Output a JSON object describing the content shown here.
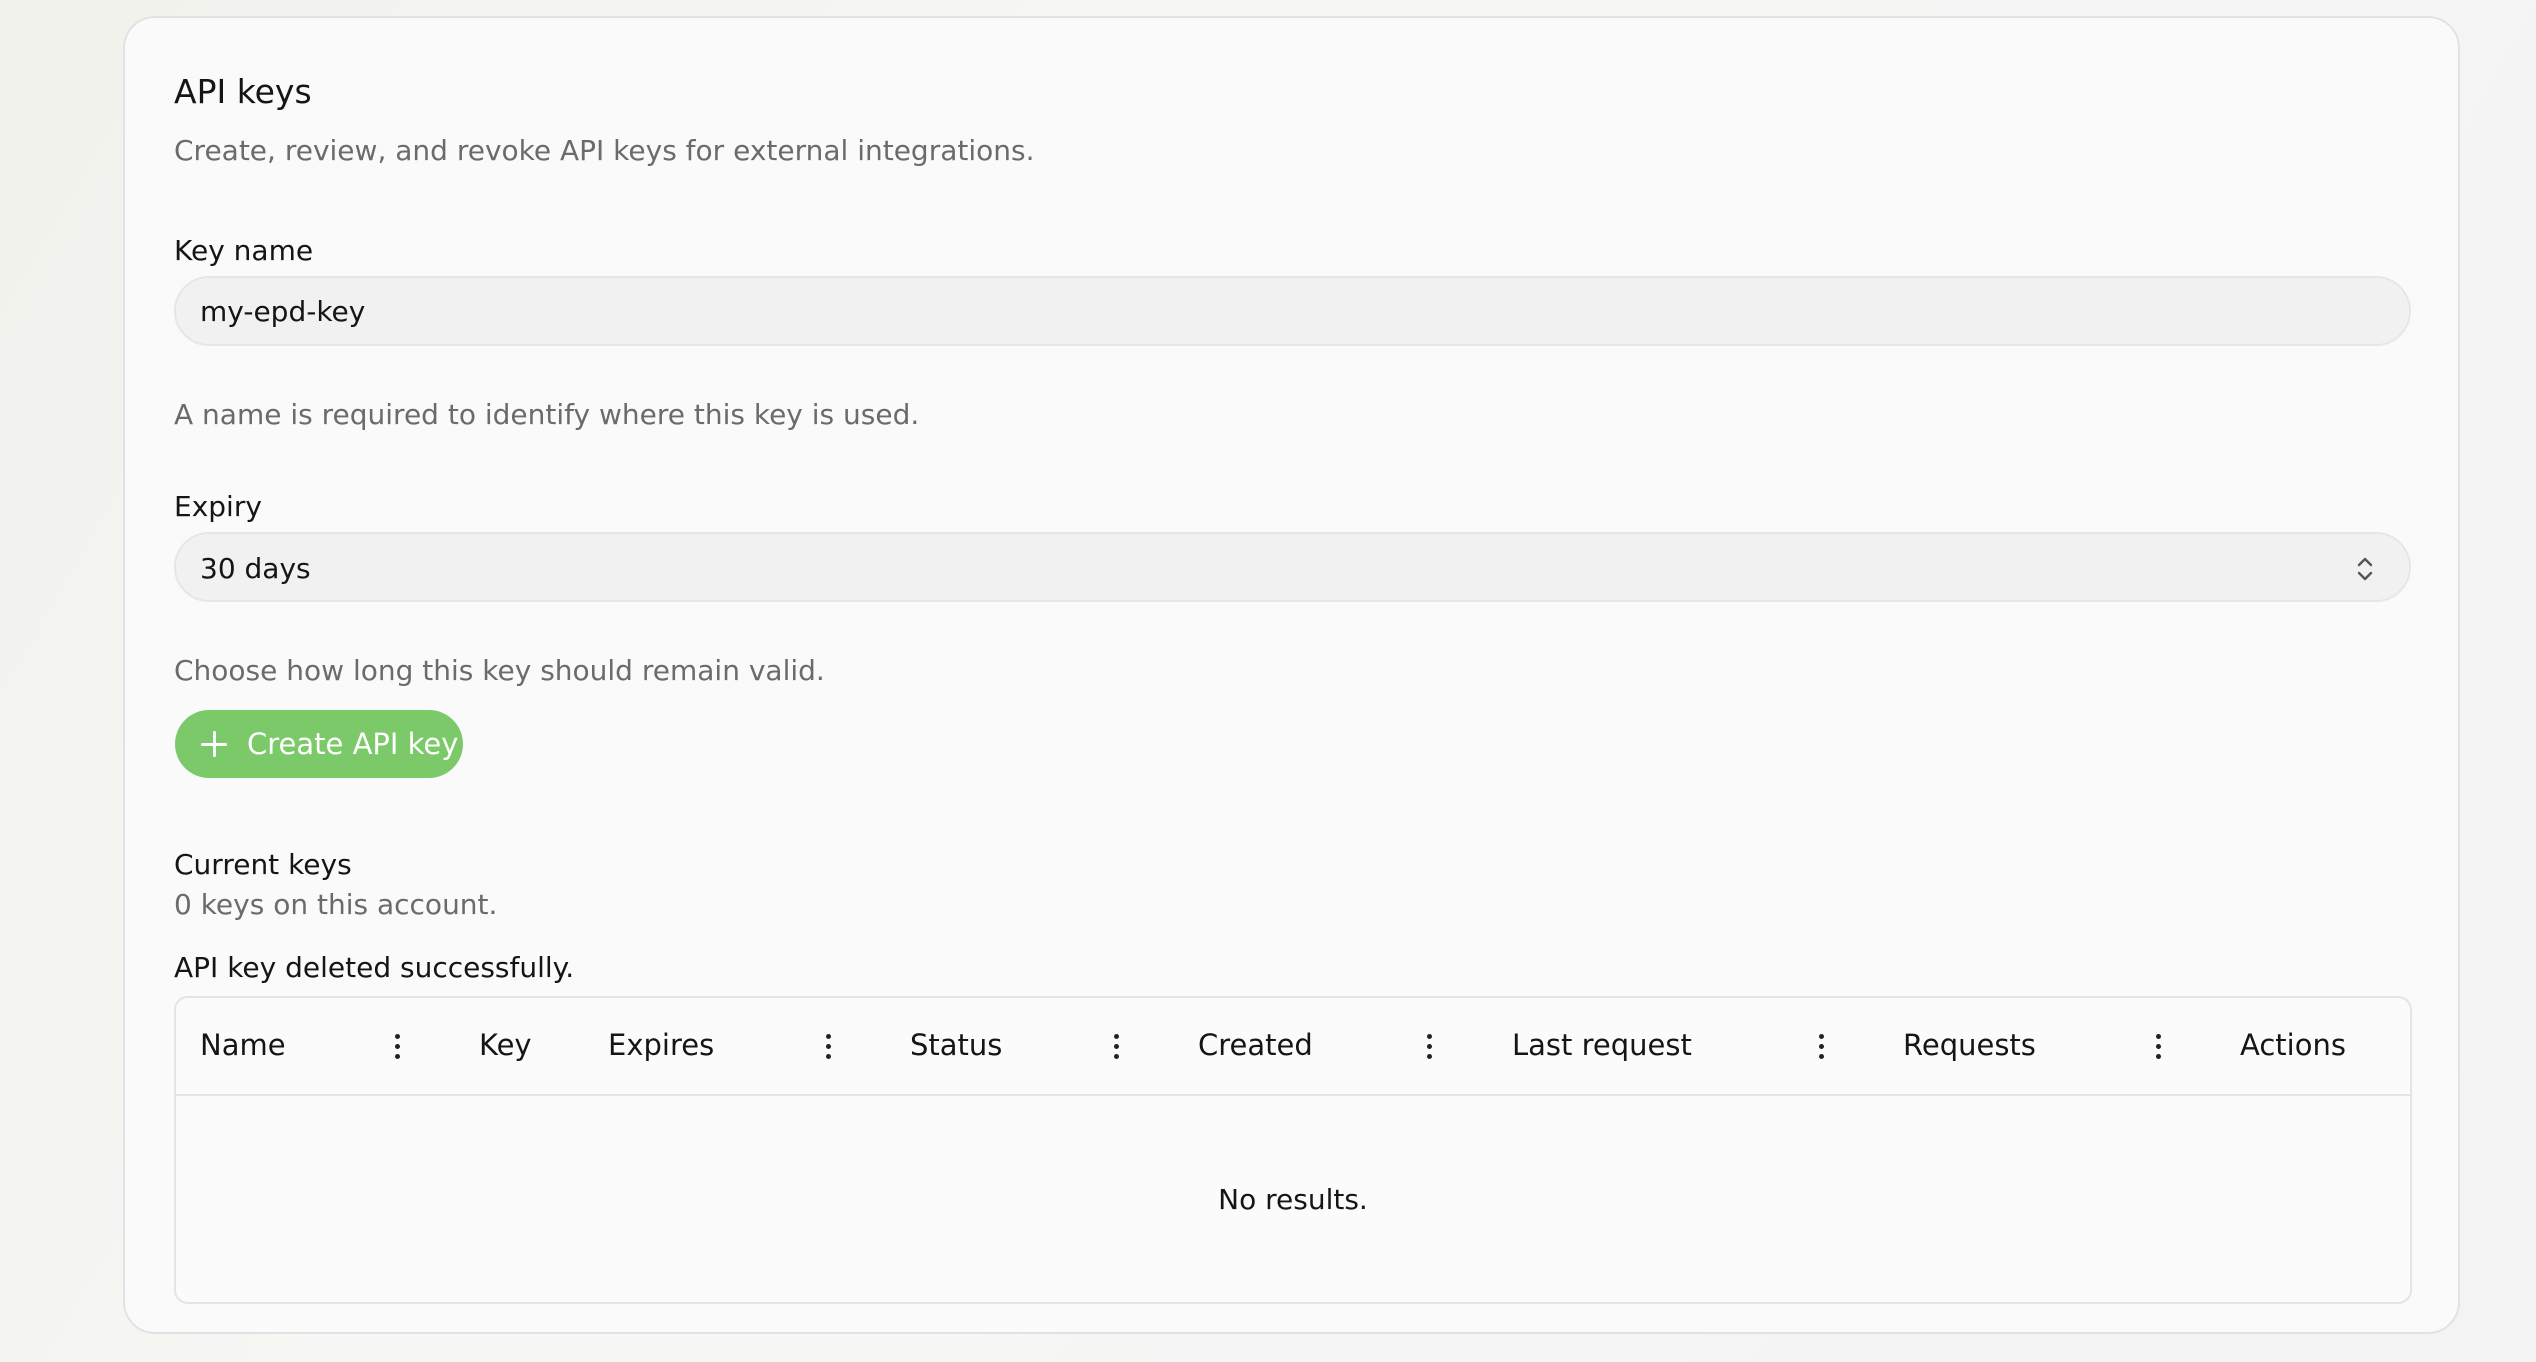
{
  "card": {
    "title": "API keys",
    "subtitle": "Create, review, and revoke API keys for external integrations."
  },
  "key_name": {
    "label": "Key name",
    "value": "my-epd-key",
    "hint": "A name is required to identify where this key is used."
  },
  "expiry": {
    "label": "Expiry",
    "selected": "30 days",
    "hint": "Choose how long this key should remain valid.",
    "icon": "chevron-up-down-icon"
  },
  "create_button": {
    "label": "Create API key",
    "icon": "plus-icon",
    "color": "#7cc96a"
  },
  "current_keys": {
    "title": "Current keys",
    "count_text": "0 keys on this account.",
    "status_message": "API key deleted successfully."
  },
  "table": {
    "columns": [
      {
        "label": "Name",
        "has_menu": true
      },
      {
        "label": "Key",
        "has_menu": false
      },
      {
        "label": "Expires",
        "has_menu": true
      },
      {
        "label": "Status",
        "has_menu": true
      },
      {
        "label": "Created",
        "has_menu": true
      },
      {
        "label": "Last request",
        "has_menu": true
      },
      {
        "label": "Requests",
        "has_menu": true
      },
      {
        "label": "Actions",
        "has_menu": false
      }
    ],
    "empty_text": "No results."
  }
}
